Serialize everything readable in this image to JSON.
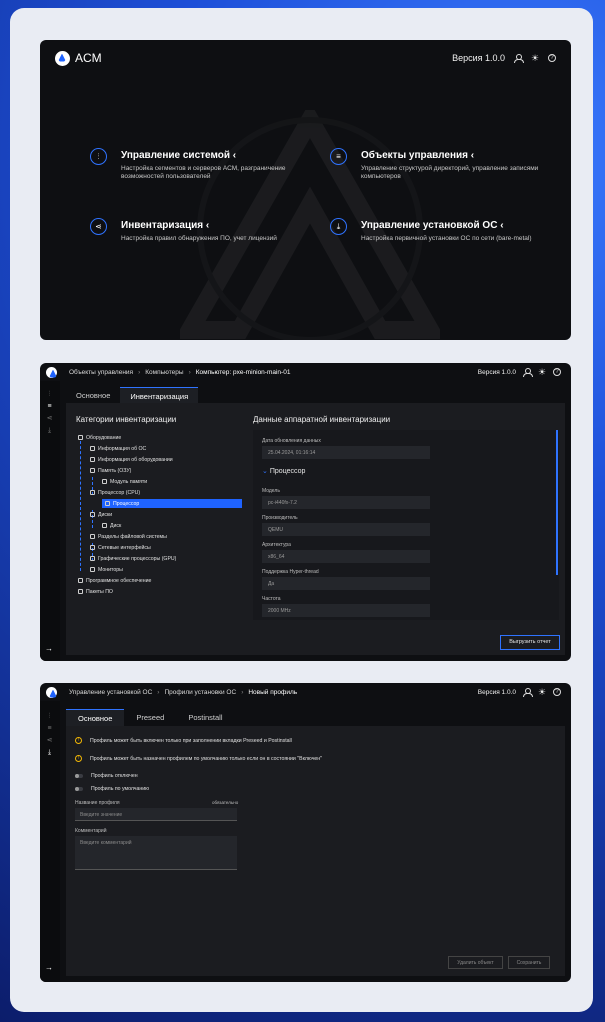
{
  "brand": {
    "name": "ACM"
  },
  "header": {
    "version": "Версия 1.0.0"
  },
  "home": {
    "tiles": [
      {
        "title": "Управление системой",
        "desc": "Настройка сегментов и серверов АСМ, разграничение возможностей пользователей",
        "icon": "sliders-icon"
      },
      {
        "title": "Объекты управления",
        "desc": "Управление структурой директорий, управление записями компьютеров",
        "icon": "list-icon"
      },
      {
        "title": "Инвентаризация",
        "desc": "Настройка правил обнаружения ПО, учет лицензий",
        "icon": "share-icon"
      },
      {
        "title": "Управление установкой ОС",
        "desc": "Настройка первичной установки ОС по сети (bare-metal)",
        "icon": "download-icon"
      }
    ]
  },
  "inventory": {
    "breadcrumb": [
      "Объекты управления",
      "Компьютеры",
      "Компьютер: pxe-minion-main-01"
    ],
    "version": "Версия 1.0.0",
    "tabs": [
      "Основное",
      "Инвентаризация"
    ],
    "categories_title": "Категории инвентаризации",
    "tree": [
      "Оборудование",
      "Информация об ОС",
      "Информация об оборудовании",
      "Память (ОЗУ)",
      "Модуль памяти",
      "Процессор (CPU)",
      "Процессор",
      "Диски",
      "Диск",
      "Разделы файловой системы",
      "Сетевые интерфейсы",
      "Графические процессоры (GPU)",
      "Мониторы",
      "Программное обеспечение",
      "Пакеты ПО"
    ],
    "data_title": "Данные аппаратной инвентаризации",
    "updated_label": "Дата обновления данных",
    "updated_value": "25.04.2024, 01:16:14",
    "section": "Процессор",
    "fields": [
      {
        "label": "Модель",
        "value": "pc-i440fx-7.2"
      },
      {
        "label": "Производитель",
        "value": "QEMU"
      },
      {
        "label": "Архитектура",
        "value": "x86_64"
      },
      {
        "label": "Поддержка Hyper-thread",
        "value": "Да"
      },
      {
        "label": "Частота",
        "value": "2000 MHz"
      }
    ],
    "export_button": "Выгрузить отчет"
  },
  "profile": {
    "breadcrumb": [
      "Управление установкой ОС",
      "Профили установки ОС",
      "Новый профиль"
    ],
    "version": "Версия 1.0.0",
    "tabs": [
      "Основное",
      "Preseed",
      "Postinstall"
    ],
    "alerts": [
      "Профиль может быть включен только при заполнении вкладки Preseed и Postinstall",
      "Профиль может быть назначен профилем по умолчанию только если он в состоянии \"Включен\""
    ],
    "toggle_disabled": "Профиль отключен",
    "toggle_default": "Профиль по умолчанию",
    "name_label": "Название профиля",
    "required": "обязательно",
    "name_placeholder": "Введите значение",
    "comment_label": "Комментарий",
    "comment_placeholder": "Введите комментарий",
    "delete_button": "Удалить объект",
    "save_button": "Сохранить"
  },
  "colors": {
    "accent": "#2f73ff",
    "background": "#1a4fd6",
    "window": "#0e0f12",
    "warning": "#f2b705"
  }
}
